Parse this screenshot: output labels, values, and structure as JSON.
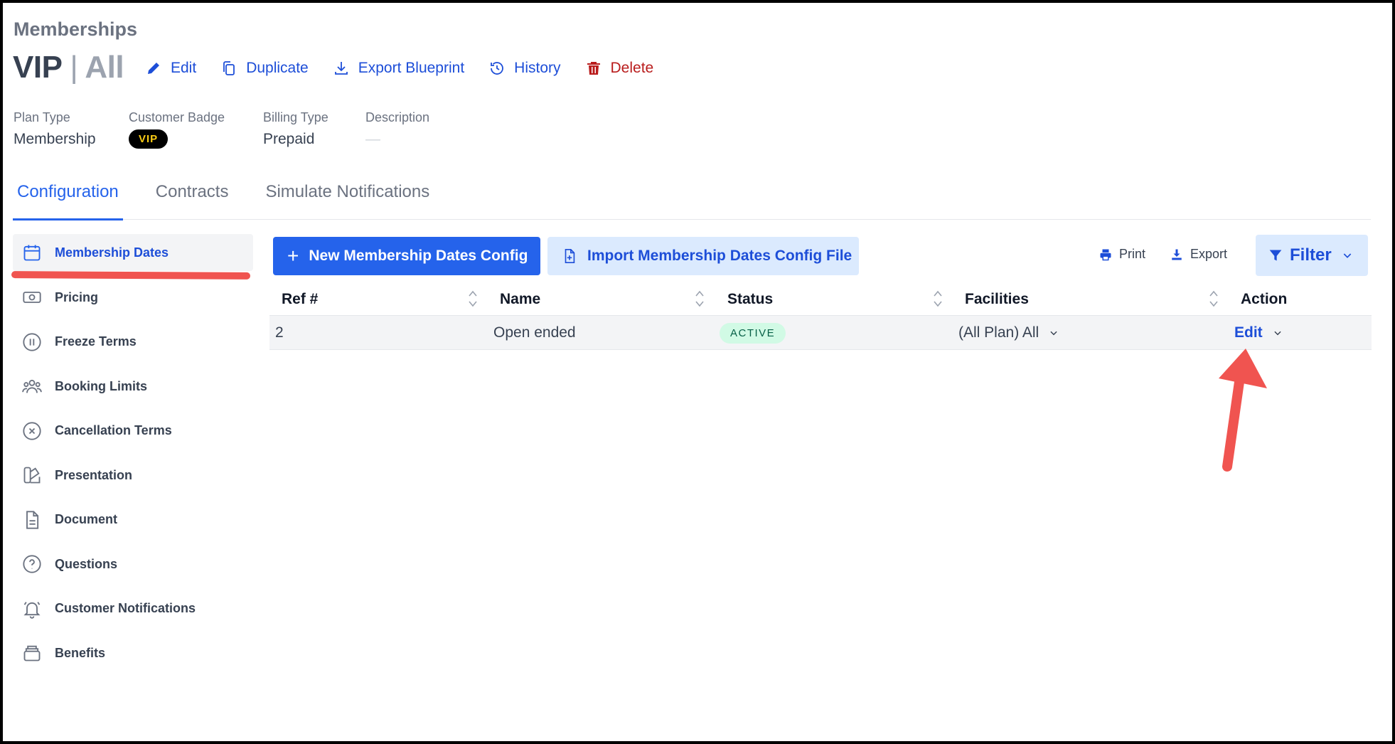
{
  "breadcrumb": "Memberships",
  "title": {
    "main": "VIP",
    "separator": "|",
    "sub": "All"
  },
  "actions": [
    {
      "label": "Edit",
      "icon": "pencil-icon"
    },
    {
      "label": "Duplicate",
      "icon": "copy-icon"
    },
    {
      "label": "Export Blueprint",
      "icon": "download-icon"
    },
    {
      "label": "History",
      "icon": "history-icon"
    },
    {
      "label": "Delete",
      "icon": "trash-icon"
    }
  ],
  "meta": {
    "plan_type": {
      "label": "Plan Type",
      "value": "Membership"
    },
    "customer_badge": {
      "label": "Customer Badge",
      "value": "VIP"
    },
    "billing_type": {
      "label": "Billing Type",
      "value": "Prepaid"
    },
    "description": {
      "label": "Description",
      "value": "—"
    }
  },
  "tabs": [
    {
      "label": "Configuration",
      "active": true
    },
    {
      "label": "Contracts",
      "active": false
    },
    {
      "label": "Simulate Notifications",
      "active": false
    }
  ],
  "sidebar": {
    "items": [
      {
        "label": "Membership Dates",
        "icon": "calendar-icon",
        "active": true
      },
      {
        "label": "Pricing",
        "icon": "cash-icon"
      },
      {
        "label": "Freeze Terms",
        "icon": "pause-circle-icon"
      },
      {
        "label": "Booking Limits",
        "icon": "users-icon"
      },
      {
        "label": "Cancellation Terms",
        "icon": "x-circle-icon"
      },
      {
        "label": "Presentation",
        "icon": "swatch-icon"
      },
      {
        "label": "Document",
        "icon": "document-icon"
      },
      {
        "label": "Questions",
        "icon": "question-circle-icon"
      },
      {
        "label": "Customer Notifications",
        "icon": "bell-icon"
      },
      {
        "label": "Benefits",
        "icon": "stack-icon"
      }
    ]
  },
  "toolbar": {
    "new_label": "New Membership Dates Config",
    "import_label": "Import Membership Dates Config File",
    "print_label": "Print",
    "export_label": "Export",
    "filter_label": "Filter"
  },
  "table": {
    "columns": [
      "Ref #",
      "Name",
      "Status",
      "Facilities",
      "Action"
    ],
    "rows": [
      {
        "ref": "2",
        "name": "Open ended",
        "status": "ACTIVE",
        "facilities": "(All Plan) All",
        "action": "Edit"
      }
    ]
  },
  "colors": {
    "accent": "#2563eb",
    "danger": "#b91c1c",
    "annotation": "#f05450",
    "active_status_bg": "#d1fae5"
  }
}
